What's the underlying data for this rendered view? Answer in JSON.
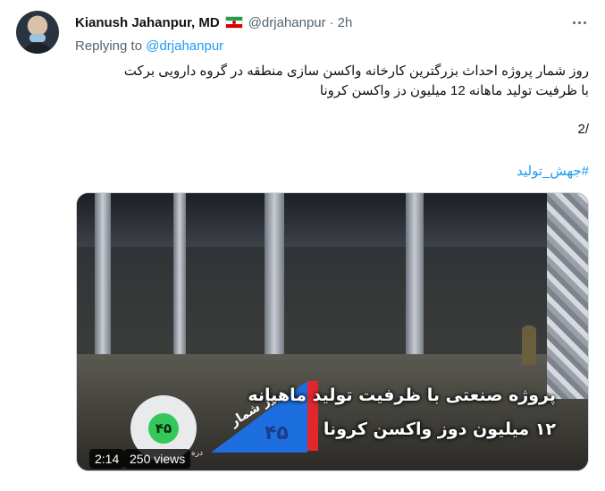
{
  "author": {
    "display_name": "Kianush Jahanpur, MD",
    "flag_icon": "iran-flag-icon",
    "handle": "@drjahanpur",
    "separator": "·",
    "time": "2h"
  },
  "reply": {
    "prefix": "Replying to ",
    "mention": "@drjahanpur"
  },
  "tweet": {
    "line1": "روز شمار پروژه احداث بزرگترین کارخانه واکسن سازی منطقه در گروه دارویی برکت",
    "line2": "با ظرفیت تولید ماهانه 12 میلیون دز واکسن کرونا",
    "thread_counter": "2/",
    "hashtag": "#جهش_تولید"
  },
  "video": {
    "duration": "2:14",
    "views": "250 views",
    "overlay": {
      "circle_number": "۴۵",
      "circle_label": "دره",
      "countdown_label": "روز شمار",
      "countdown_number": "۴۵",
      "banner_line1": "پروژه صنعتی با ظرفیت تولید ماهیانه",
      "banner_line2": "۱۲ میلیون دوز واکسن کرونا"
    }
  },
  "colors": {
    "link": "#1d9bf0",
    "secondary_text": "#536471",
    "overlay_red": "#e3262b",
    "overlay_blue": "#1d6fe0",
    "overlay_green": "#34c759"
  }
}
